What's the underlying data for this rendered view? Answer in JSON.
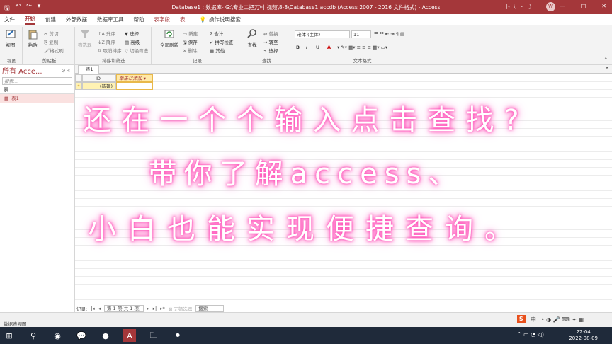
{
  "window": {
    "title": "Database1 : 数据库- G:\\专业二把刀\\中视频\\8-8\\Database1.accdb (Access 2007 - 2016 文件格式) - Access",
    "user_initial": "W",
    "extra_chars": "卜 ㇂ ㇀ ㇁",
    "controls": [
      "—",
      "□",
      "✕"
    ]
  },
  "tabs": [
    "文件",
    "开始",
    "创建",
    "外部数据",
    "数据库工具",
    "帮助",
    "表字段",
    "表"
  ],
  "tell_me": "操作说明搜索",
  "ribbon": {
    "views": {
      "button": "视图",
      "label": "视图"
    },
    "clipboard": {
      "paste": "粘贴",
      "cut": "剪切",
      "copy": "复制",
      "format_painter": "格式刷",
      "label": "剪贴板"
    },
    "sort": {
      "filter": "筛选器",
      "asc": "升序",
      "desc": "降序",
      "remove": "取消排序",
      "selection": "选择",
      "advanced": "高级",
      "toggle": "切换筛选",
      "label": "排序和筛选"
    },
    "records": {
      "refresh": "全部刷新",
      "new": "新建",
      "save": "保存",
      "delete": "删除",
      "totals": "合计",
      "spelling": "拼写检查",
      "more": "其他",
      "label": "记录"
    },
    "find": {
      "find": "查找",
      "replace": "替换",
      "goto": "转至",
      "select": "选择",
      "label": "查找"
    },
    "text": {
      "font": "宋体 (主体)",
      "size": "11",
      "bold": "B",
      "italic": "I",
      "underline": "U",
      "font_color": "A",
      "label": "文本格式"
    }
  },
  "nav": {
    "title": "所有 Acce...",
    "search_placeholder": "搜索...",
    "section": "表",
    "item": "表1"
  },
  "doc_tab": "表1",
  "datasheet": {
    "columns": [
      "ID",
      "单击以添加"
    ],
    "new_row_marker": "*",
    "new_row_value": "(新建)"
  },
  "record_nav": {
    "label": "记录:",
    "current": "第 1 项(共 1 项)",
    "no_filter": "无筛选器",
    "search": "搜索",
    "arrows": [
      "|◂",
      "◂",
      "▸",
      "▸|",
      "▸*"
    ]
  },
  "status": {
    "text": "数据表视图",
    "ime": "中",
    "clock_time": "22:04",
    "clock_date": "2022-08-09"
  },
  "overlay": {
    "line1": "还在一个个输入点击查找?",
    "line2": "带你了解access、",
    "line3": "小白也能实现便捷查询。"
  }
}
